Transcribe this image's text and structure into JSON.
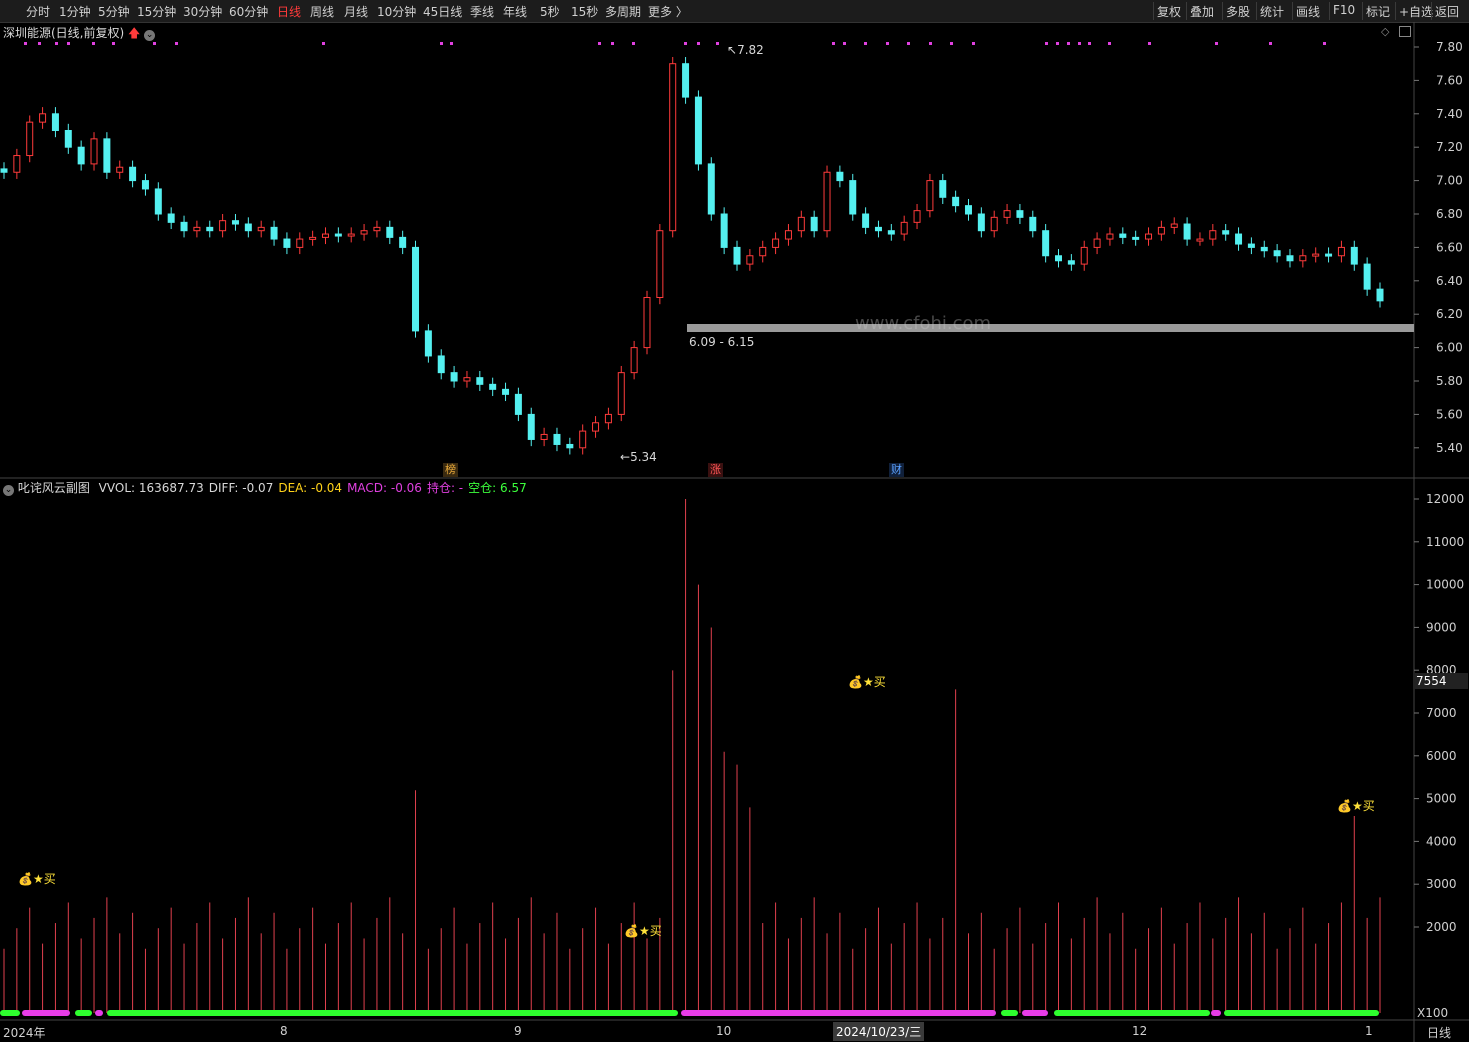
{
  "toolbar": {
    "periods": [
      "分时",
      "1分钟",
      "5分钟",
      "15分钟",
      "30分钟",
      "60分钟",
      "日线",
      "周线",
      "月线",
      "10分钟",
      "45日线",
      "季线",
      "年线",
      "5秒",
      "15秒",
      "多周期",
      "更多 〉"
    ],
    "active_period": "日线",
    "right_buttons": [
      "复权",
      "叠加",
      "多股",
      "统计",
      "画线",
      "F10",
      "标记",
      "+自选",
      "返回"
    ]
  },
  "main_chart": {
    "title": "深圳能源(日线,前复权)",
    "title_icon": "red-up-arrow-icon",
    "price_axis": [
      "7.80",
      "7.60",
      "7.40",
      "7.20",
      "7.00",
      "6.80",
      "6.60",
      "6.40",
      "6.20",
      "6.00",
      "5.80",
      "5.60",
      "5.40"
    ],
    "high_label": "7.82",
    "low_label": "5.34",
    "range_label": "6.09 - 6.15",
    "watermark": "www.cfohi.com",
    "badges": [
      {
        "text": "榜",
        "color": "#e8a93a"
      },
      {
        "text": "涨",
        "color": "#ff5555"
      },
      {
        "text": "财",
        "color": "#5aa0ff"
      }
    ],
    "colors": {
      "up": "#ff3b3b",
      "down": "#54f0f0",
      "mark": "#e040e0",
      "band": "#9a9a9a"
    }
  },
  "sub_chart": {
    "name": "叱诧风云副图",
    "indicators": [
      {
        "label": "VVOL: 163687.73",
        "color": "#d8d8d8"
      },
      {
        "label": "DIFF: -0.07",
        "color": "#d8d8d8"
      },
      {
        "label": "DEA: -0.04",
        "color": "#ffd21a"
      },
      {
        "label": "MACD: -0.06",
        "color": "#e040e0"
      },
      {
        "label": "持仓: -",
        "color": "#e040e0"
      },
      {
        "label": "空仓: 6.57",
        "color": "#3cff3c"
      }
    ],
    "volume_axis": [
      "12000",
      "11000",
      "10000",
      "9000",
      "8000",
      "7000",
      "6000",
      "5000",
      "4000",
      "3000",
      "2000"
    ],
    "cursor_value": "7554",
    "unit": "X100",
    "buy_label": "★买",
    "colors": {
      "bar": "#e0404e",
      "hold": "#e83ce8",
      "empty": "#2eff2e"
    }
  },
  "x_axis": {
    "labels": [
      "2024年",
      "8",
      "9",
      "10",
      "12",
      "1"
    ],
    "cursor_date": "2024/10/23/三",
    "period": "日线"
  }
}
